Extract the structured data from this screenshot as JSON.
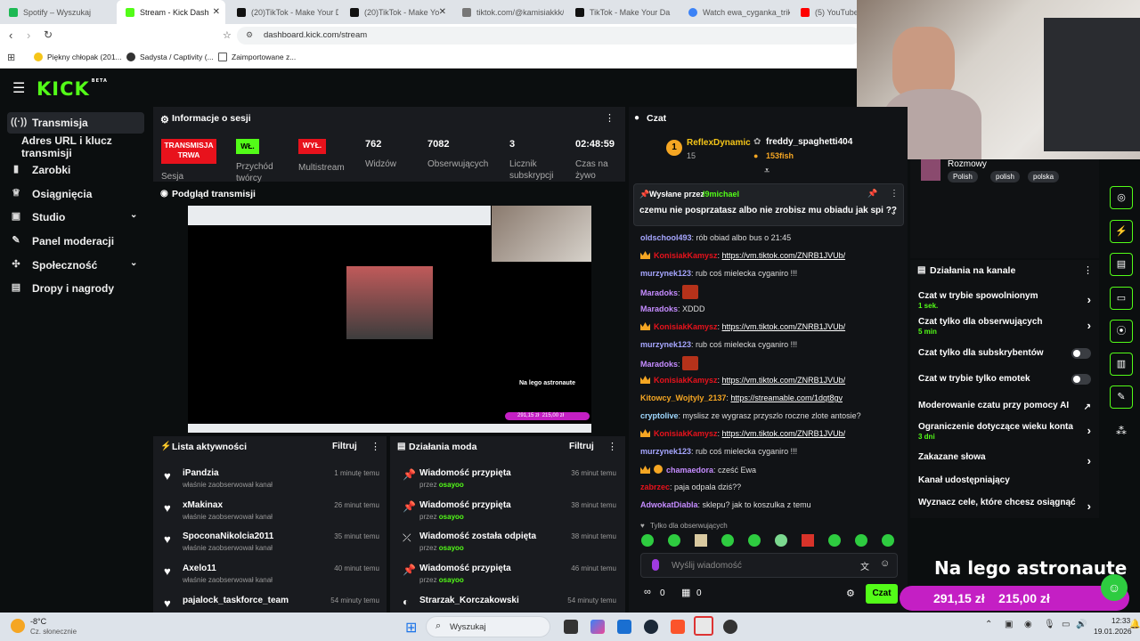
{
  "browser": {
    "tabs": [
      {
        "title": "Spotify – Wyszukaj",
        "color": "#1db954",
        "active": false
      },
      {
        "title": "Stream - Kick Dash",
        "color": "#53fc18",
        "active": true
      },
      {
        "title": "(20)TikTok - Make Your Da",
        "color": "#111111",
        "active": false
      },
      {
        "title": "(20)TikTok - Make Yo",
        "color": "#111111",
        "active": false
      },
      {
        "title": "tiktok.com/@kamisiakkk/",
        "color": "#777777",
        "active": false
      },
      {
        "title": "TikTok - Make Your Da",
        "color": "#111111",
        "active": false
      },
      {
        "title": "Watch ewa_cyganka_triki",
        "color": "#3b82f6",
        "active": false
      },
      {
        "title": "(5) YouTube",
        "color": "#ff0000",
        "active": false
      }
    ],
    "url": "dashboard.kick.com/stream",
    "bookmarks": [
      "Piękny chłopak (201...",
      "Sadysta / Captivity (...",
      "Zaimportowane z..."
    ]
  },
  "brand": {
    "logo": "KICK",
    "beta": "BETA",
    "accent": "#53fc18"
  },
  "sidebar": {
    "items": [
      {
        "label": "Transmisja",
        "icon": "broadcast-icon",
        "active": true
      },
      {
        "label": "Adres URL i klucz transmisji",
        "icon": "",
        "active": false
      },
      {
        "label": "Zarobki",
        "icon": "chart-icon",
        "active": false
      },
      {
        "label": "Osiągnięcia",
        "icon": "trophy-icon",
        "active": false
      },
      {
        "label": "Studio",
        "icon": "studio-icon",
        "active": false
      },
      {
        "label": "Panel moderacji",
        "icon": "wrench-icon",
        "active": false
      },
      {
        "label": "Społeczność",
        "icon": "community-icon",
        "active": false
      },
      {
        "label": "Dropy i nagrody",
        "icon": "gift-icon",
        "active": false
      }
    ]
  },
  "session": {
    "title": "Informacje o sesji",
    "live_badge": "TRANSMISJA TRWA",
    "session_label": "Sesja",
    "fwd_badge": "WŁ.",
    "fwd_label": "Przychód twórcy",
    "multistream_badge": "WYŁ.",
    "multistream_label": "Multistream",
    "viewers": "762",
    "viewers_label": "Widzów",
    "followers": "7082",
    "followers_label": "Obserwujących",
    "subs": "3",
    "subs_label": "Licznik subskrypcji",
    "uptime": "02:48:59",
    "uptime_label": "Czas na żywo"
  },
  "preview": {
    "title": "Podgląd transmisji",
    "overlay_title": "Na lego astronaute",
    "overlay_val1": "291,15 zł",
    "overlay_val2": "215,00 zł"
  },
  "activity": {
    "title": "Lista aktywności",
    "filter": "Filtruj",
    "rows": [
      {
        "name": "iPandzia",
        "sub": "właśnie zaobserwował kanał",
        "time": "1 minutę temu"
      },
      {
        "name": "xMakinax",
        "sub": "właśnie zaobserwował kanał",
        "time": "26 minut temu"
      },
      {
        "name": "SpoconaNikolcia2011",
        "sub": "właśnie zaobserwował kanał",
        "time": "35 minut temu"
      },
      {
        "name": "Axelo11",
        "sub": "właśnie zaobserwował kanał",
        "time": "40 minut temu"
      },
      {
        "name": "pajalock_taskforce_team",
        "sub": "",
        "time": "54 minuty temu"
      }
    ]
  },
  "modactions": {
    "title": "Działania moda",
    "filter": "Filtruj",
    "rows": [
      {
        "name": "Wiadomość przypięta",
        "by": "przez",
        "who": "osayoo",
        "time": "36 minut temu"
      },
      {
        "name": "Wiadomość przypięta",
        "by": "przez",
        "who": "osayoo",
        "time": "38 minut temu"
      },
      {
        "name": "Wiadomość została odpięta",
        "by": "przez",
        "who": "osayoo",
        "time": "38 minut temu"
      },
      {
        "name": "Wiadomość przypięta",
        "by": "przez",
        "who": "osayoo",
        "time": "46 minut temu"
      },
      {
        "name": "Strarzak_Korczakowski",
        "by": "",
        "who": "",
        "time": "54 minuty temu"
      }
    ]
  },
  "chat": {
    "title": "Czat",
    "top_gifter_rank": "1",
    "top_gifter": "ReflexDynamic",
    "top_gifter_count": "15",
    "gifter2": "freddy_spaghetti404",
    "gifter2_count": "153fish",
    "pinned_by_label": "Wysłane przez",
    "pinned_by": "l9michael",
    "pinned_msg": "czemu nie posprzatasz albo nie zrobisz mu obiadu jak spi ??",
    "messages": [
      {
        "user": "oldschool493",
        "color": "#a6a6ff",
        "text": ": rób obiad albo bus o 21:45",
        "link": "",
        "crown": false,
        "emote": false
      },
      {
        "user": "KonisiakKamysz",
        "color": "#e8121c",
        "text": ": ",
        "link": "https://vm.tiktok.com/ZNRB1JVUb/",
        "crown": true,
        "emote": false
      },
      {
        "user": "murzynek123",
        "color": "#a6a6ff",
        "text": ": rub coś mielecka cyganiro !!!",
        "link": "",
        "crown": false,
        "emote": false
      },
      {
        "user": "Maradoks",
        "color": "#c58cff",
        "text": ": ",
        "link": "",
        "crown": false,
        "emote": true
      },
      {
        "user": "Maradoks",
        "color": "#c58cff",
        "text": ": XDDD",
        "link": "",
        "crown": false,
        "emote": false
      },
      {
        "user": "KonisiakKamysz",
        "color": "#e8121c",
        "text": ": ",
        "link": "https://vm.tiktok.com/ZNRB1JVUb/",
        "crown": true,
        "emote": false
      },
      {
        "user": "murzynek123",
        "color": "#a6a6ff",
        "text": ": rub coś mielecka cyganiro !!!",
        "link": "",
        "crown": false,
        "emote": false
      },
      {
        "user": "Maradoks",
        "color": "#c58cff",
        "text": ": ",
        "link": "",
        "crown": false,
        "emote": true
      },
      {
        "user": "KonisiakKamysz",
        "color": "#e8121c",
        "text": ": ",
        "link": "https://vm.tiktok.com/ZNRB1JVUb/",
        "crown": true,
        "emote": false
      },
      {
        "user": "Kitowcy_Wojtyly_2137",
        "color": "#f5a623",
        "text": ": ",
        "link": "https://streamable.com/1dqt8gv",
        "crown": false,
        "emote": false
      },
      {
        "user": "cryptolive",
        "color": "#9fd8ff",
        "text": ": myslisz ze wygrasz przyszlo roczne zlote antosie?",
        "link": "",
        "crown": false,
        "emote": false
      },
      {
        "user": "KonisiakKamysz",
        "color": "#e8121c",
        "text": ": ",
        "link": "https://vm.tiktok.com/ZNRB1JVUb/",
        "crown": true,
        "emote": false
      },
      {
        "user": "murzynek123",
        "color": "#a6a6ff",
        "text": ": rub coś mielecka cyganiro !!!",
        "link": "",
        "crown": false,
        "emote": false
      },
      {
        "user": "chamaedora",
        "color": "#c58cff",
        "text": ": cześć Ewa",
        "link": "",
        "crown": true,
        "emote": false
      },
      {
        "user": "zabrzec",
        "color": "#e8121c",
        "text": ": paja odpala dziś??",
        "link": "",
        "crown": false,
        "emote": false
      },
      {
        "user": "AdwokatDiabla",
        "color": "#c58cff",
        "text": ": sklepu? jak to koszulka z temu",
        "link": "",
        "crown": false,
        "emote": false
      }
    ],
    "followers_only": "Tylko dla obserwujących",
    "input_placeholder": "Wyślij wiadomość",
    "infinity": "0",
    "gift_count": "0",
    "send": "Czat"
  },
  "right": {
    "category": "Rozmowy",
    "tags": [
      "Polish",
      "polish",
      "polska"
    ],
    "actions_title": "Działania na kanale",
    "actions": [
      {
        "label": "Czat w trybie spowolnionym",
        "value": "1 sek.",
        "kind": "arrow"
      },
      {
        "label": "Czat tylko dla obserwujących",
        "value": "5 min",
        "kind": "arrow"
      },
      {
        "label": "Czat tylko dla subskrybentów",
        "value": "",
        "kind": "toggle"
      },
      {
        "label": "Czat w trybie tylko emotek",
        "value": "",
        "kind": "toggle"
      },
      {
        "label": "Moderowanie czatu przy pomocy AI",
        "value": "",
        "kind": "link"
      },
      {
        "label": "Ograniczenie dotyczące wieku konta",
        "value": "3 dni",
        "kind": "arrow"
      },
      {
        "label": "Zakazane słowa",
        "value": "",
        "kind": "arrow"
      },
      {
        "label": "Kanał udostępniający",
        "value": "",
        "kind": "none"
      },
      {
        "label": "Wyznacz cele, które chcesz osiągnąć",
        "value": "",
        "kind": "arrow"
      }
    ],
    "overlay_title": "Na lego astronaute",
    "overlay_val1": "291,15 zł",
    "overlay_val2": "215,00 zł"
  },
  "taskbar": {
    "temp": "-8°C",
    "weather": "Cz. słonecznie",
    "search": "Wyszukaj",
    "time": "12:33",
    "date": "19.01.2026"
  }
}
